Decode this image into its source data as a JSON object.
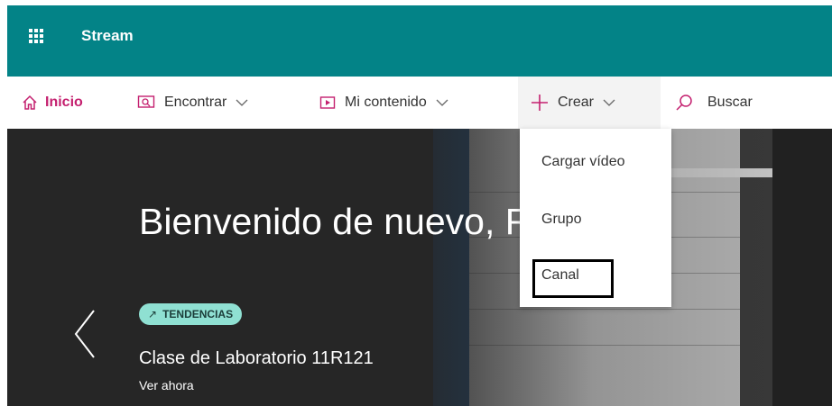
{
  "app": {
    "name": "Stream"
  },
  "nav": {
    "home": "Inicio",
    "find": "Encontrar",
    "my_content": "Mi contenido",
    "create": "Crear",
    "search": "Buscar"
  },
  "create_menu": {
    "items": [
      "Cargar vídeo",
      "Grupo",
      "Canal"
    ],
    "highlighted": "Canal"
  },
  "hero": {
    "headline": "Bienvenido de nuevo, Rys",
    "badge": "TENDENCIAS",
    "video_title": "Clase de Laboratorio 11R121",
    "action": "Ver ahora"
  },
  "colors": {
    "header_bg": "#038387",
    "accent": "#c4206f",
    "badge_bg": "#8fe0d2"
  },
  "icons": [
    "app-launcher-icon",
    "home-icon",
    "find-icon",
    "video-icon",
    "plus-icon",
    "chevron-down-icon",
    "search-icon",
    "chevron-left-icon",
    "trending-icon"
  ]
}
